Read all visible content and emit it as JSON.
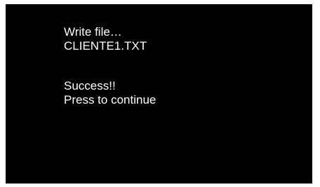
{
  "screen": {
    "background_color": "#000000",
    "text_color": "#ffffff",
    "operation": "Write file…",
    "filename": "CLIENTE1.TXT",
    "status": "Success!!",
    "prompt": "Press to continue"
  }
}
